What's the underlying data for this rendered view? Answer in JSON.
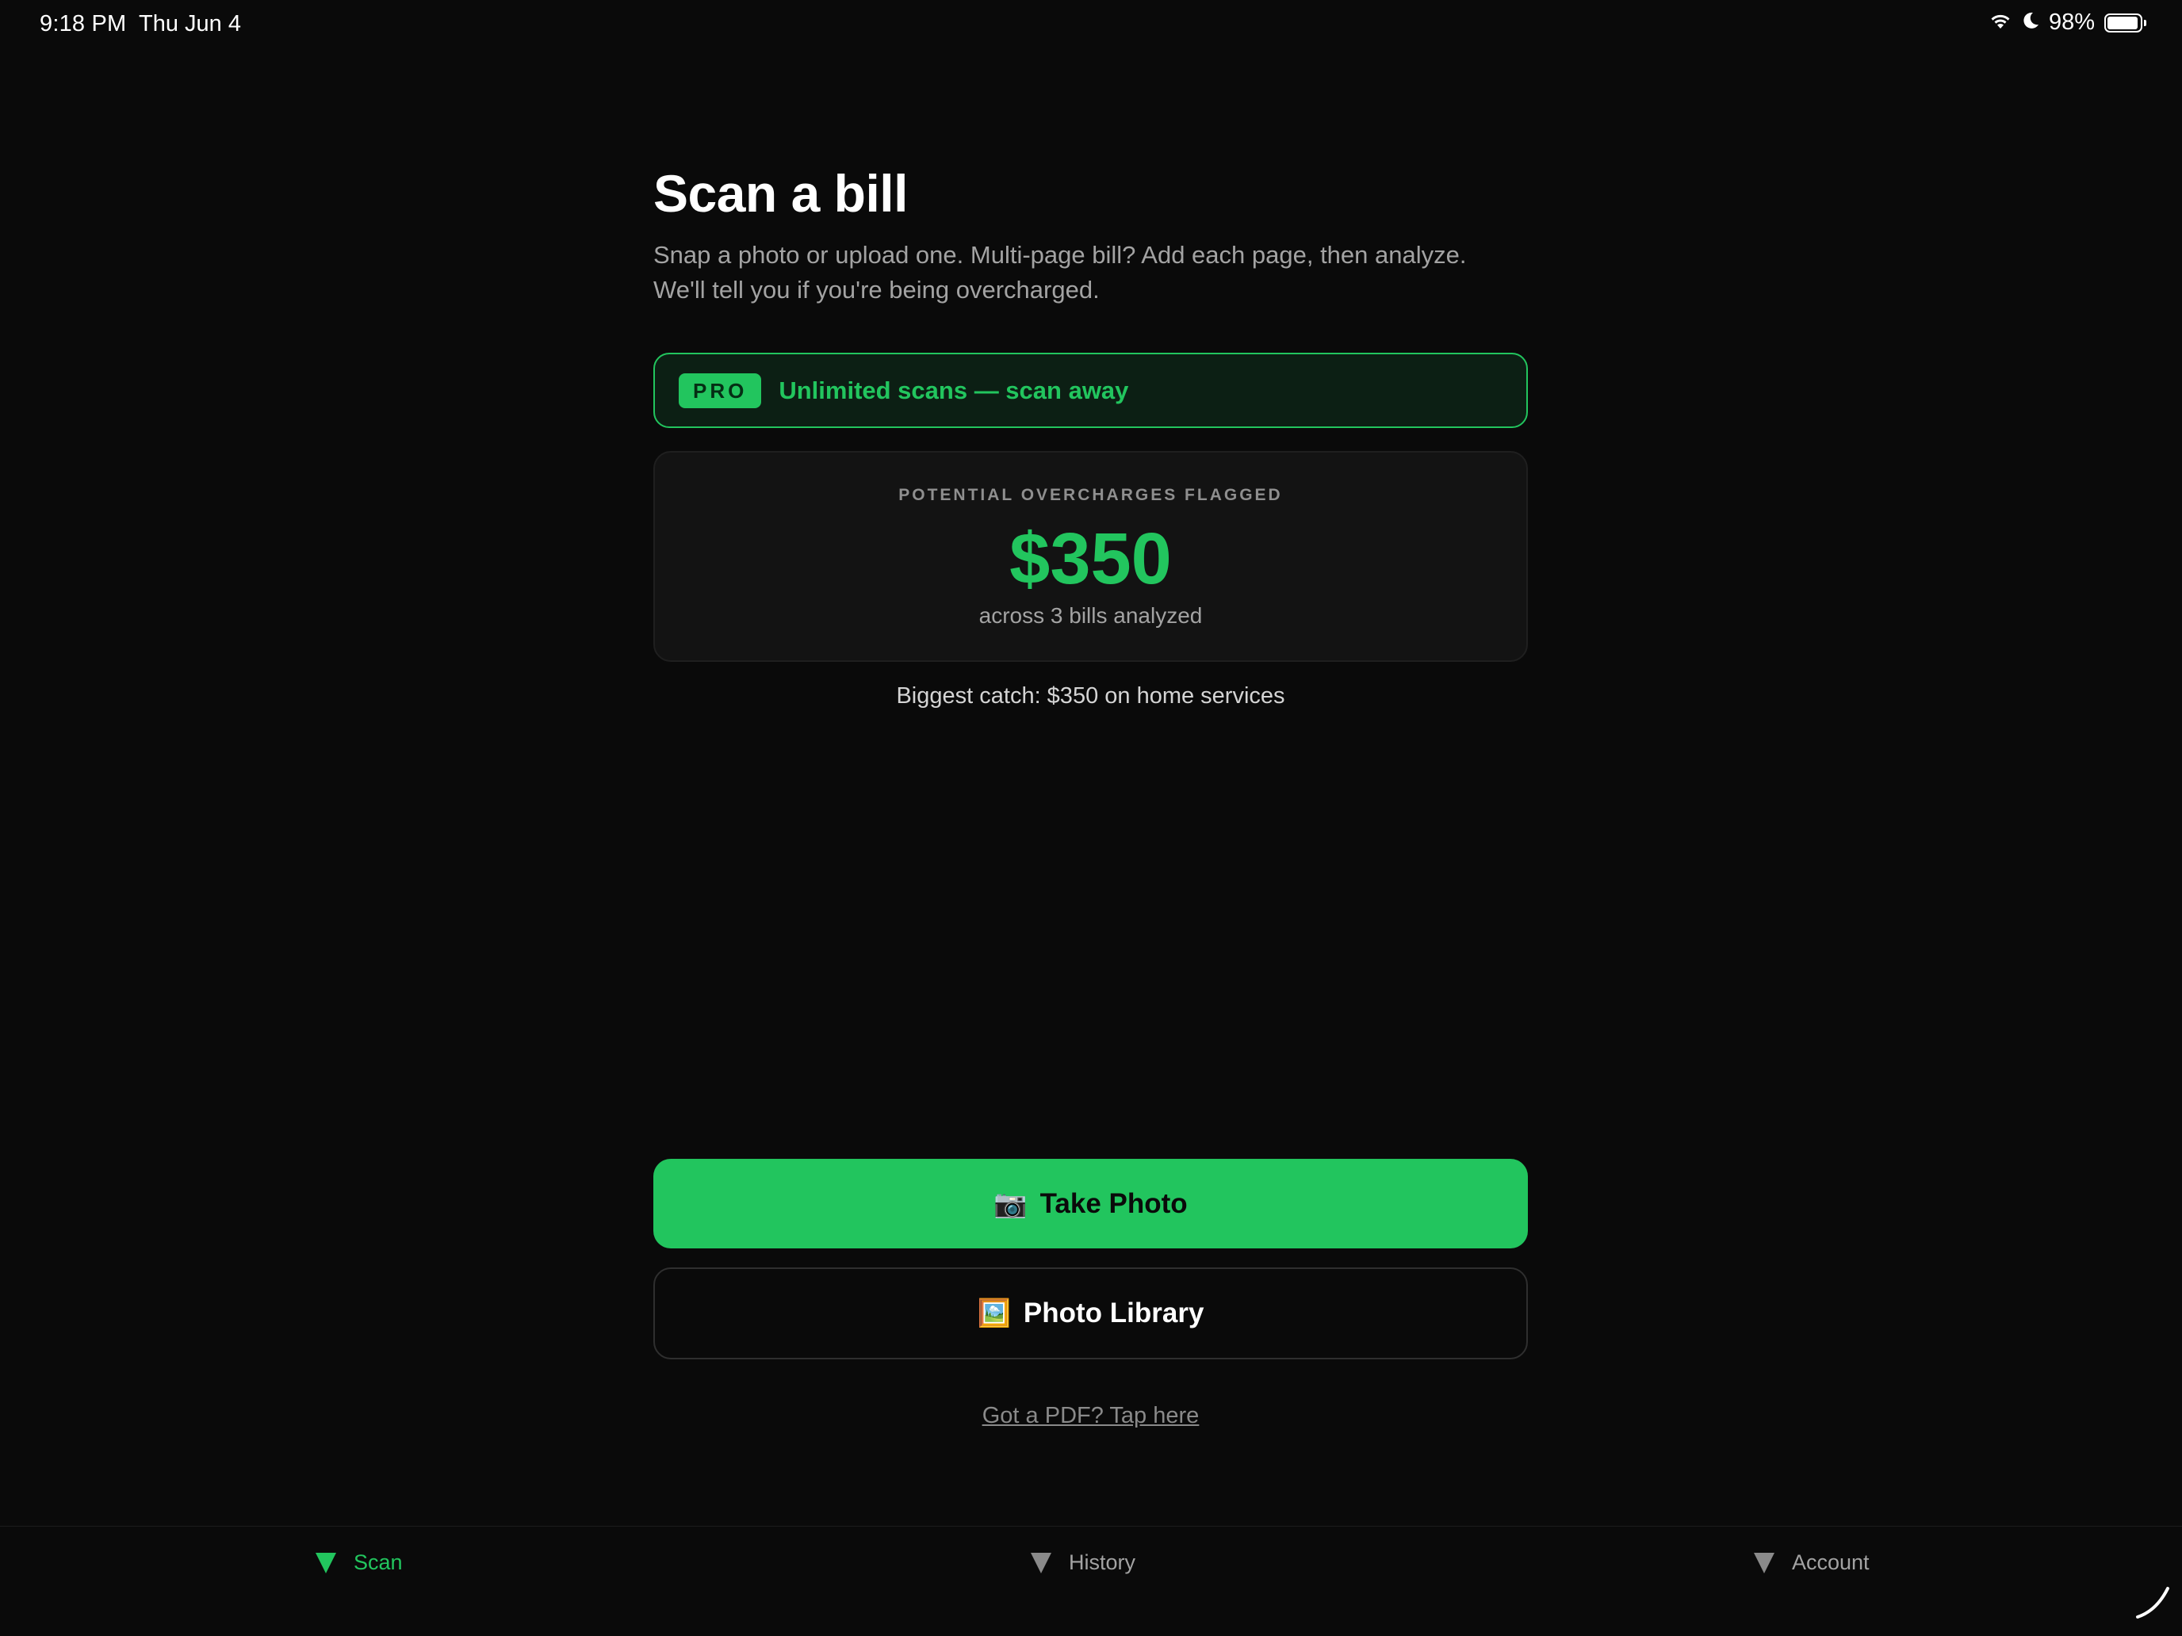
{
  "status_bar": {
    "time": "9:18 PM",
    "date": "Thu Jun 4",
    "battery": "98%",
    "icons": [
      "wifi-icon",
      "moon-icon",
      "battery-icon"
    ]
  },
  "header": {
    "title": "Scan a bill",
    "subtitle_line1": "Snap a photo or upload one. Multi-page bill? Add each page, then analyze.",
    "subtitle_line2": "We'll tell you if you're being overcharged."
  },
  "pro_banner": {
    "badge": "PRO",
    "text": "Unlimited scans — scan away"
  },
  "stats": {
    "label": "POTENTIAL OVERCHARGES FLAGGED",
    "amount": "$350",
    "sub": "across 3 bills analyzed"
  },
  "biggest_catch": "Biggest catch: $350 on home services",
  "actions": {
    "take_photo": {
      "icon": "📷",
      "label": "Take Photo"
    },
    "photo_library": {
      "icon": "🖼️",
      "label": "Photo Library"
    },
    "pdf_link": "Got a PDF? Tap here"
  },
  "tabs": [
    {
      "label": "Scan",
      "active": true
    },
    {
      "label": "History",
      "active": false
    },
    {
      "label": "Account",
      "active": false
    }
  ],
  "colors": {
    "background": "#0a0a0a",
    "accent": "#22c55e",
    "card": "#131313",
    "muted_text": "#a3a3a3"
  }
}
